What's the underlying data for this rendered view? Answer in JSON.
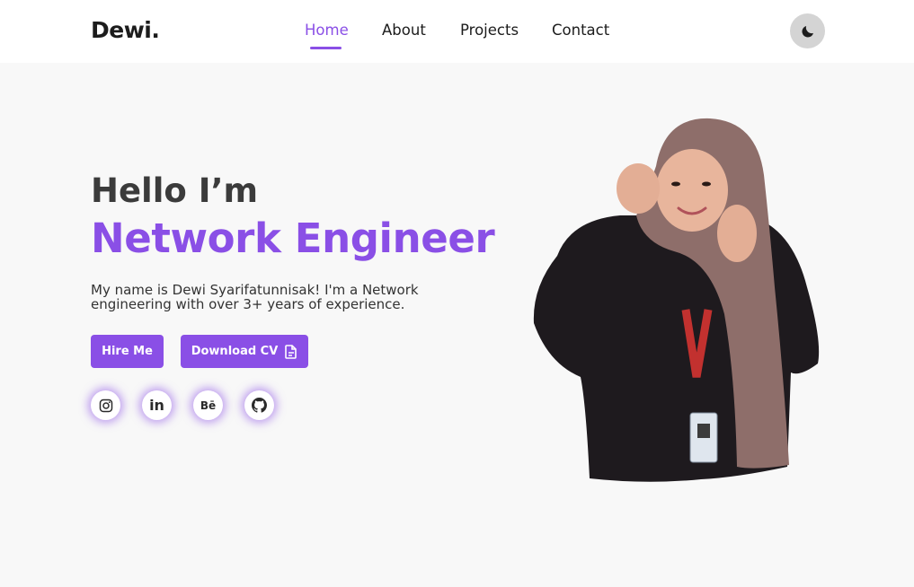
{
  "header": {
    "logo": "Dewi.",
    "nav": [
      {
        "label": "Home",
        "active": true
      },
      {
        "label": "About",
        "active": false
      },
      {
        "label": "Projects",
        "active": false
      },
      {
        "label": "Contact",
        "active": false
      }
    ],
    "theme_toggle_icon": "moon-icon"
  },
  "hero": {
    "greeting": "Hello I’m",
    "title": "Network Engineer",
    "description": "My name is Dewi Syarifatunnisak! I'm a Network engineering with over 3+ years of experience.",
    "buttons": {
      "hire": "Hire Me",
      "download": "Download CV",
      "download_icon": "document-icon"
    },
    "socials": [
      {
        "name": "instagram-icon"
      },
      {
        "name": "linkedin-icon",
        "glyph": "in"
      },
      {
        "name": "behance-icon",
        "glyph": "Bē"
      },
      {
        "name": "github-icon"
      }
    ]
  },
  "colors": {
    "accent": "#8a4fe6",
    "text_dark": "#1c1c1c",
    "background": "#f8f8f8",
    "header_bg": "#ffffff",
    "toggle_bg": "#d4d4d4"
  }
}
